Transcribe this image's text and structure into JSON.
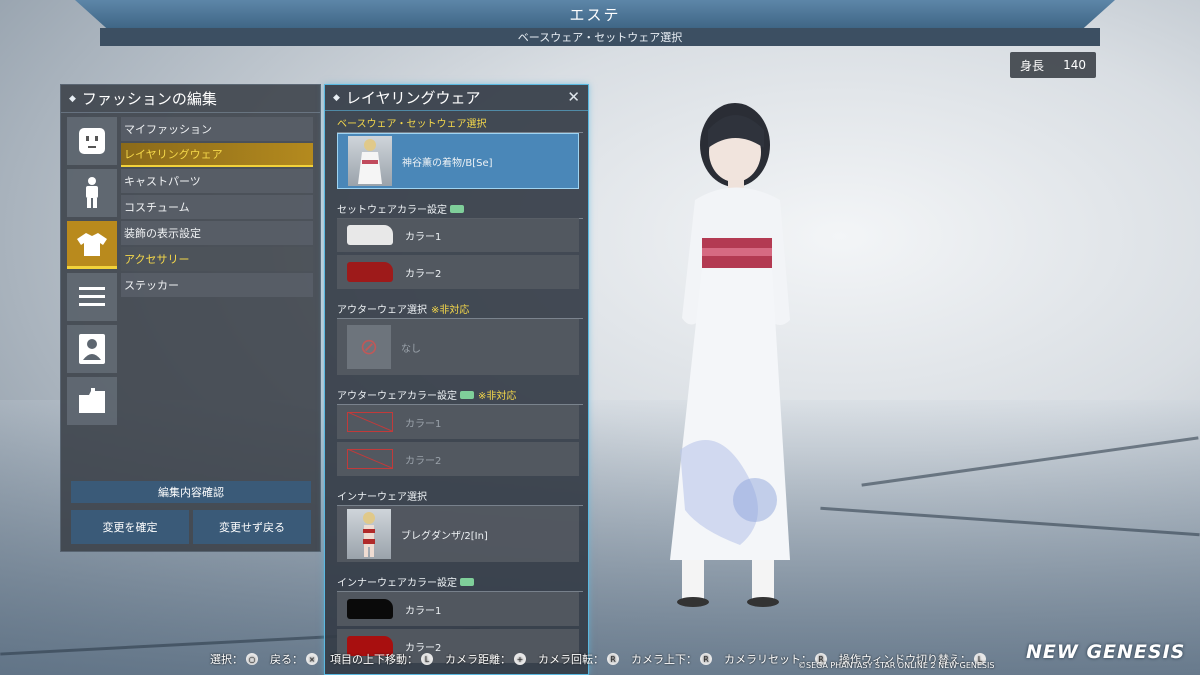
{
  "header": {
    "title": "エステ",
    "subtitle": "ベースウェア・セットウェア選択",
    "height_label": "身長",
    "height_value": "140"
  },
  "left_panel": {
    "title": "ファッションの編集",
    "icons": [
      "face-icon",
      "body-icon",
      "shirt-icon",
      "menu-icon",
      "profile-icon",
      "folder-icon"
    ],
    "menu": [
      {
        "label": "マイファッション",
        "state": "normal"
      },
      {
        "label": "レイヤリングウェア",
        "state": "active"
      },
      {
        "label": "キャストパーツ",
        "state": "normal"
      },
      {
        "label": "コスチューム",
        "state": "normal"
      },
      {
        "label": "装飾の表示設定",
        "state": "normal"
      },
      {
        "label": "アクセサリー",
        "state": "highlight"
      },
      {
        "label": "ステッカー",
        "state": "normal"
      }
    ],
    "confirm_label": "編集内容確認",
    "apply_label": "変更を確定",
    "cancel_label": "変更せず戻る"
  },
  "layer_panel": {
    "title": "レイヤリングウェア",
    "base_section": "ベースウェア・セットウェア選択",
    "base_item": "神谷薫の着物/B[Se]",
    "set_color_section": "セットウェアカラー設定",
    "set_colors": [
      {
        "label": "カラー1",
        "color": "#e8e8e8"
      },
      {
        "label": "カラー2",
        "color": "#9e1a1a"
      }
    ],
    "outer_section": "アウターウェア選択",
    "unsupported_note": "※非対応",
    "outer_item": "なし",
    "outer_color_section": "アウターウェアカラー設定",
    "outer_colors": [
      {
        "label": "カラー1"
      },
      {
        "label": "カラー2"
      }
    ],
    "inner_section": "インナーウェア選択",
    "inner_item": "ブレグダンザ/2[In]",
    "inner_color_section": "インナーウェアカラー設定",
    "inner_colors": [
      {
        "label": "カラー1",
        "color": "#0a0a0a"
      },
      {
        "label": "カラー2",
        "color": "#a80f0f"
      }
    ]
  },
  "controls": [
    {
      "label": "選択：",
      "icon": "circle-button-icon"
    },
    {
      "label": "戻る：",
      "icon": "cross-button-icon"
    },
    {
      "label": "項目の上下移動：",
      "icon": "ls-icon"
    },
    {
      "label": "カメラ距離：",
      "icon": "dpad-icon"
    },
    {
      "label": "カメラ回転：",
      "icon": "rs-icon"
    },
    {
      "label": "カメラ上下：",
      "icon": "r3-icon"
    },
    {
      "label": "カメラリセット：",
      "icon": "r3-press-icon"
    },
    {
      "label": "操作ウィンドウ切り替え：",
      "icon": "l2-icon"
    }
  ],
  "copyright": "©SEGA PHANTASY STAR ONLINE 2 NEW GENESIS",
  "logo": "NEW GENESIS"
}
